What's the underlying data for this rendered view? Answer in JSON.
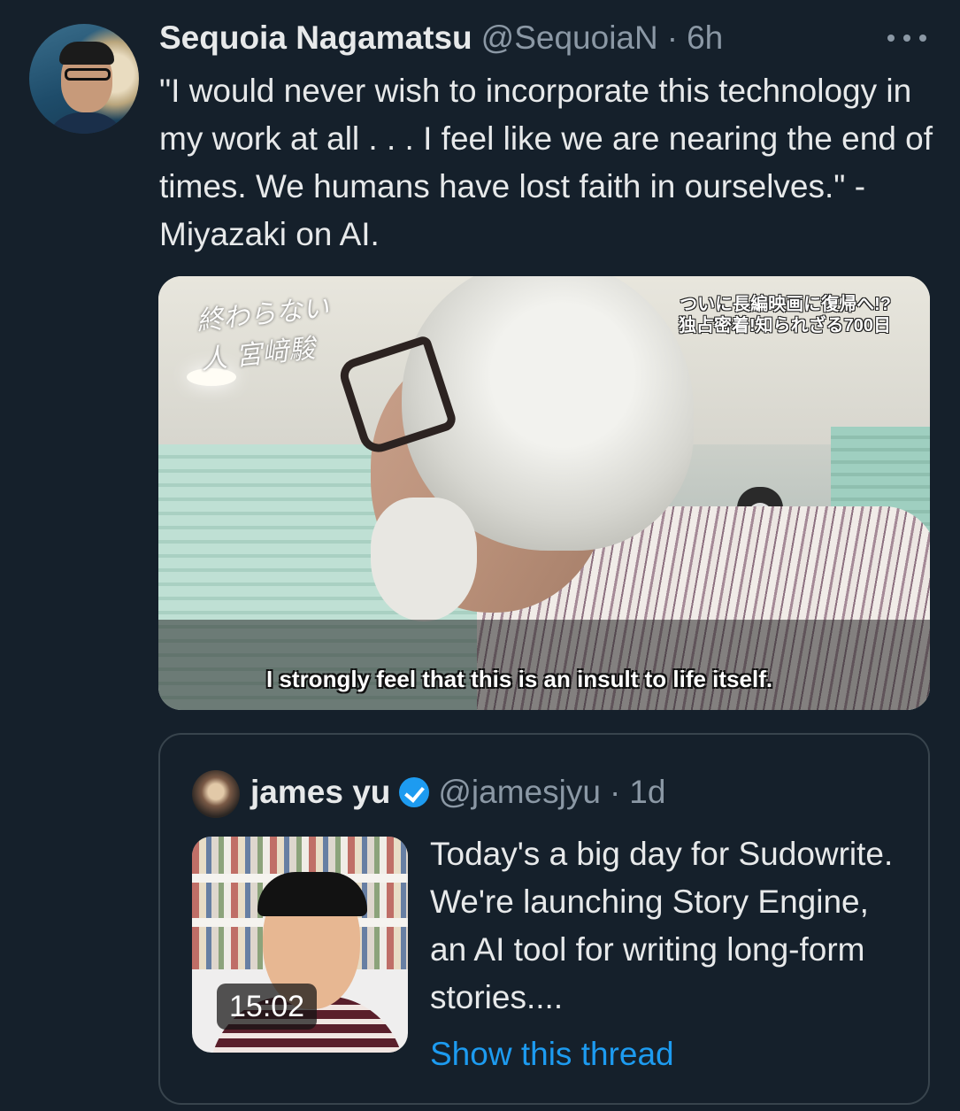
{
  "tweet": {
    "author_name": "Sequoia Nagamatsu",
    "author_handle": "@SequoiaN",
    "separator": "·",
    "time": "6h",
    "text": "\"I would never wish to incorporate this technology in my work at all . . . I feel like we are nearing the end of times. We humans have lost faith in ourselves.\" - Miyazaki on AI.",
    "more_icon": "more-horizontal-icon"
  },
  "video": {
    "subtitle": "I strongly feel that this is an insult to life itself.",
    "logo_text": "終わらない人 宮﨑駿",
    "banner_line1": "ついに長編映画に復帰へ!?",
    "banner_line2": "独占密着!知られざる700日"
  },
  "quoted": {
    "author_name": "james yu",
    "verified_icon": "verified-badge-icon",
    "author_handle": "@jamesjyu",
    "separator": "·",
    "time": "1d",
    "duration": "15:02",
    "text": "Today's a big day for Sudowrite. We're launching Story Engine, an AI tool for writing long-form stories....",
    "show_thread": "Show this thread"
  },
  "colors": {
    "background": "#15202b",
    "text": "#e7e9ea",
    "muted": "#8b98a5",
    "link": "#1d9bf0",
    "border": "#38444d"
  }
}
